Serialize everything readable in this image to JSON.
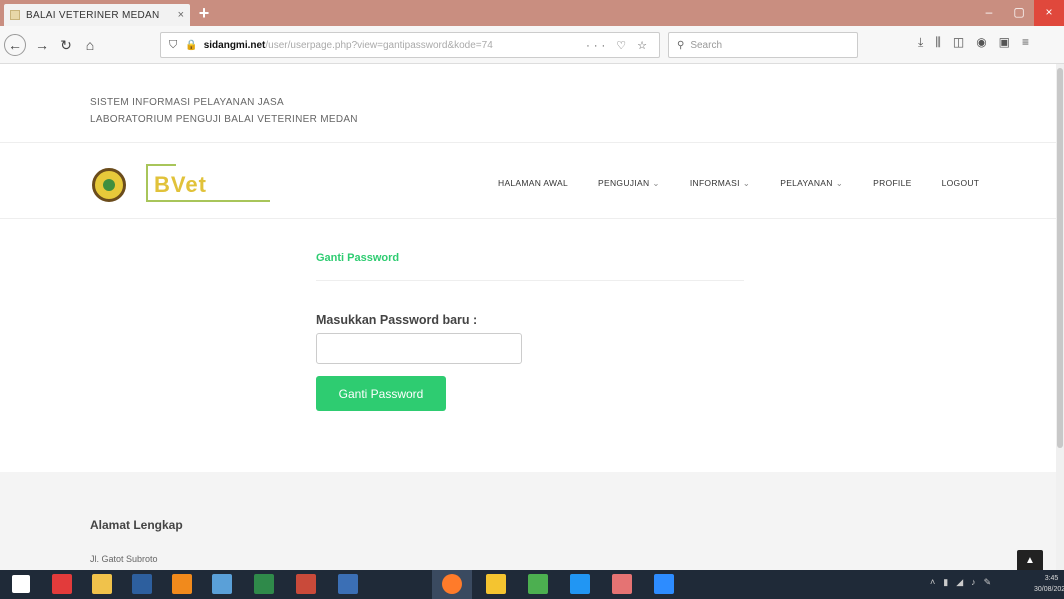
{
  "browser": {
    "tab_title": "BALAI VETERINER MEDAN",
    "tab_close": "×",
    "new_tab": "+",
    "window_controls": [
      "–",
      "▢",
      "×"
    ],
    "url_host": "sidangmi.net",
    "url_path": "/user/userpage.php?view=gantipassword&kode=74",
    "url_actions": "··· ♡ ☆",
    "search_placeholder": "Search",
    "tool_icons": [
      "download-icon",
      "library-icon",
      "sidebar-icon",
      "extension-icon",
      "extension-icon",
      "menu-icon"
    ]
  },
  "site": {
    "header_line1": "SISTEM INFORMASI PELAYANAN JASA",
    "header_line2": "LABORATORIUM PENGUJI BALAI VETERINER MEDAN",
    "logo_text": "BVet",
    "nav": [
      {
        "label": "HALAMAN AWAL",
        "has_caret": false
      },
      {
        "label": "PENGUJIAN",
        "has_caret": true
      },
      {
        "label": "INFORMASI",
        "has_caret": true
      },
      {
        "label": "PELAYANAN",
        "has_caret": true
      },
      {
        "label": "PROFILE",
        "has_caret": false
      },
      {
        "label": "LOGOUT",
        "has_caret": false
      }
    ]
  },
  "form": {
    "section_title": "Ganti Password",
    "label": "Masukkan Password baru :",
    "input_value": "",
    "submit_label": "Ganti Password"
  },
  "footer": {
    "title": "Alamat Lengkap",
    "address": "Jl. Gatot Subroto"
  },
  "taskbar": {
    "clock_time": "3:45",
    "clock_date": "30/08/2020"
  },
  "colors": {
    "accent": "#2ecc71",
    "titlebar": "#c98e80",
    "taskbar": "#1f2a38"
  }
}
